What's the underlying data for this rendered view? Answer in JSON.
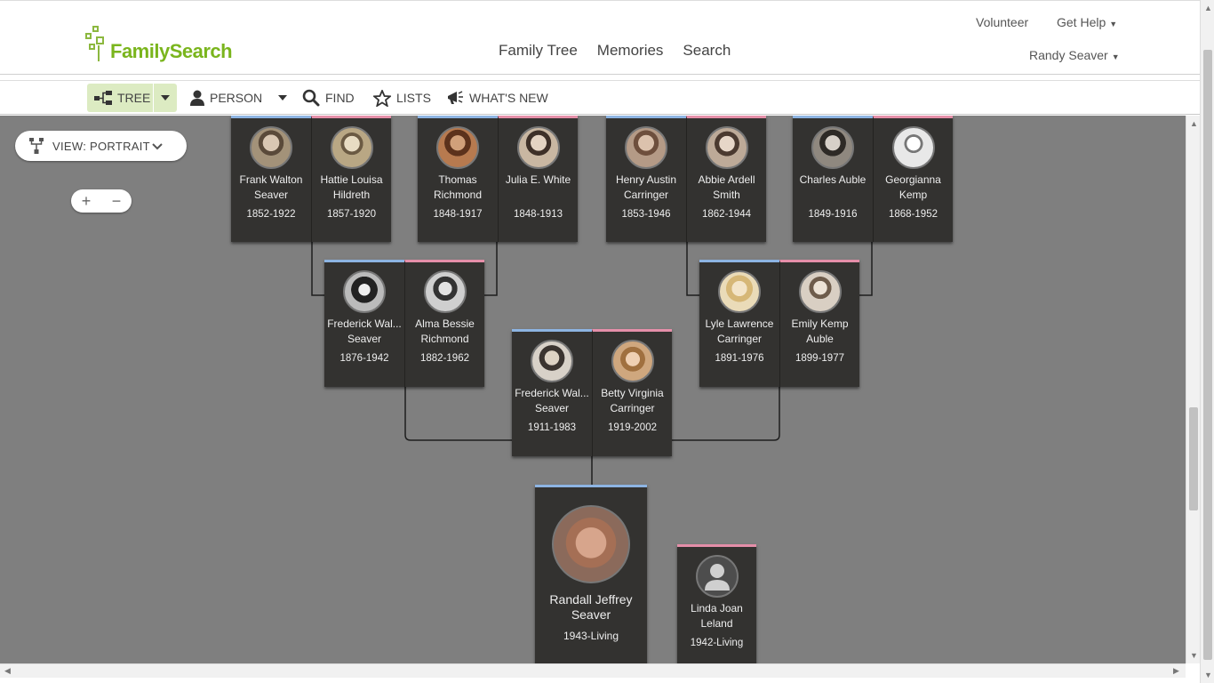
{
  "header": {
    "logo_text": "FamilySearch",
    "nav": [
      "Family Tree",
      "Memories",
      "Search"
    ],
    "volunteer": "Volunteer",
    "get_help": "Get Help",
    "user": "Randy Seaver"
  },
  "toolbar": {
    "tree": "TREE",
    "person": "PERSON",
    "find": "FIND",
    "lists": "LISTS",
    "whats_new": "WHAT'S NEW"
  },
  "canvas": {
    "view_label": "VIEW: PORTRAIT",
    "zoom_in": "+",
    "zoom_out": "−"
  },
  "colors": {
    "male": "#8db4e2",
    "female": "#e58fa9",
    "accent": "#7ab51d",
    "canvas": "#7f7f7f"
  },
  "tree": {
    "gen3": [
      {
        "husband": {
          "name": "Frank Walton Seaver",
          "dates": "1852-1922"
        },
        "wife": {
          "name": "Hattie Louisa Hildreth",
          "dates": "1857-1920"
        }
      },
      {
        "husband": {
          "name": "Thomas Richmond",
          "dates": "1848-1917"
        },
        "wife": {
          "name": "Julia E. White",
          "dates": "1848-1913"
        }
      },
      {
        "husband": {
          "name": "Henry Austin Carringer",
          "dates": "1853-1946"
        },
        "wife": {
          "name": "Abbie Ardell Smith",
          "dates": "1862-1944"
        }
      },
      {
        "husband": {
          "name": "Charles Auble",
          "dates": "1849-1916"
        },
        "wife": {
          "name": "Georgianna Kemp",
          "dates": "1868-1952"
        }
      }
    ],
    "gen2": [
      {
        "husband": {
          "name": "Frederick Wal... Seaver",
          "dates": "1876-1942"
        },
        "wife": {
          "name": "Alma Bessie Richmond",
          "dates": "1882-1962"
        }
      },
      {
        "husband": {
          "name": "Lyle Lawrence Carringer",
          "dates": "1891-1976"
        },
        "wife": {
          "name": "Emily Kemp Auble",
          "dates": "1899-1977"
        }
      }
    ],
    "gen1": {
      "husband": {
        "name": "Frederick Wal... Seaver",
        "dates": "1911-1983"
      },
      "wife": {
        "name": "Betty Virginia Carringer",
        "dates": "1919-2002"
      }
    },
    "root": {
      "name": "Randall Jeffrey Seaver",
      "dates": "1943-Living"
    },
    "spouse": {
      "name": "Linda Joan Leland",
      "dates": "1942-Living"
    }
  }
}
